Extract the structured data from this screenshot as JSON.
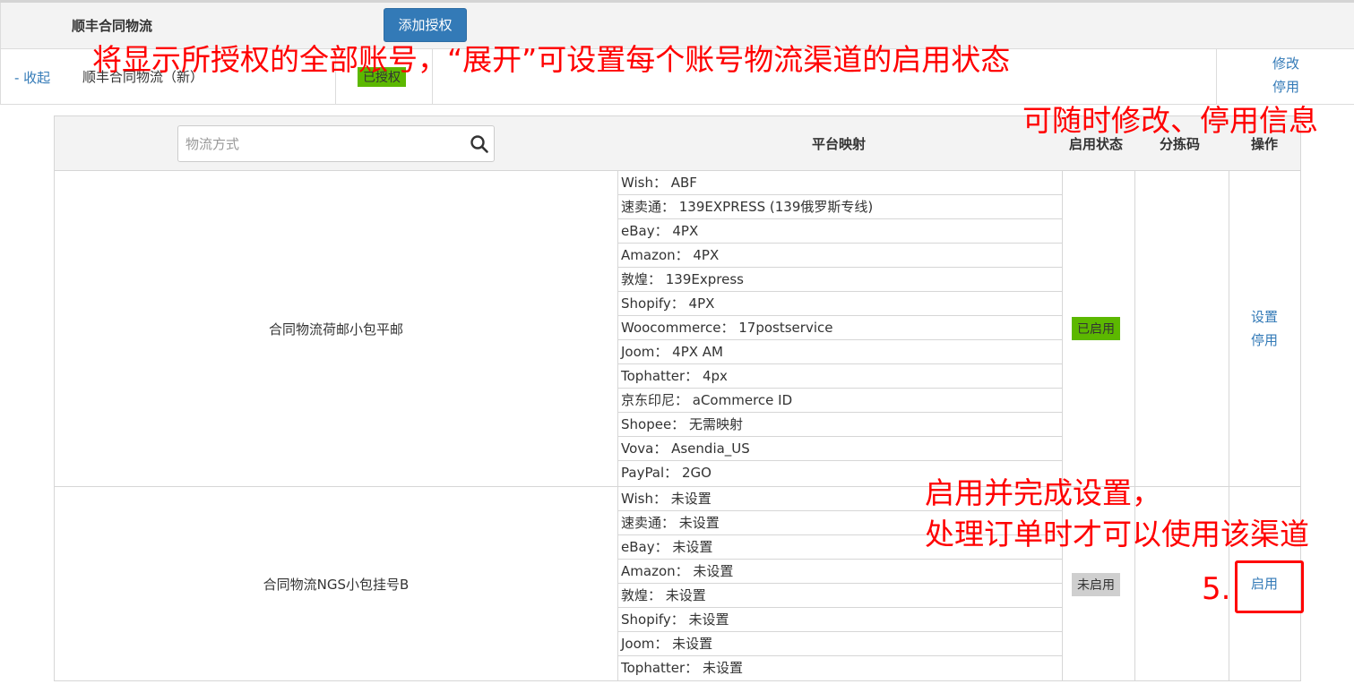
{
  "header": {
    "title": "顺丰合同物流",
    "add_button": "添加授权"
  },
  "account": {
    "collapse": "- 收起",
    "name": "顺丰合同物流（新）",
    "auth_status": "已授权",
    "ops": [
      "修改",
      "停用"
    ]
  },
  "table": {
    "search_placeholder": "物流方式",
    "headers": {
      "mapping": "平台映射",
      "status": "启用状态",
      "code": "分拣码",
      "ops": "操作"
    },
    "channels": [
      {
        "name": "合同物流荷邮小包平邮",
        "status": "已启用",
        "mappings": [
          "Wish： ABF",
          "速卖通： 139EXPRESS (139俄罗斯专线)",
          "eBay： 4PX",
          "Amazon： 4PX",
          "敦煌： 139Express",
          "Shopify： 4PX",
          "Woocommerce： 17postservice",
          "Joom： 4PX AM",
          "Tophatter： 4px",
          "京东印尼： aCommerce ID",
          "Shopee： 无需映射",
          "Vova： Asendia_US",
          "PayPal： 2GO"
        ],
        "ops": [
          "设置",
          "停用"
        ]
      },
      {
        "name": "合同物流NGS小包挂号B",
        "status": "未启用",
        "mappings": [
          "Wish： 未设置",
          "速卖通： 未设置",
          "eBay： 未设置",
          "Amazon： 未设置",
          "敦煌： 未设置",
          "Shopify： 未设置",
          "Joom： 未设置",
          "Tophatter： 未设置"
        ],
        "ops": [
          "启用"
        ]
      }
    ]
  },
  "annotations": {
    "a1": "将显示所授权的全部账号，“展开”可设置每个账号物流渠道的启用状态",
    "a2": "可随时修改、停用信息",
    "a3_line1": "启用并完成设置，",
    "a3_line2": "处理订单时才可以使用该渠道",
    "a4": "5."
  },
  "colors": {
    "primary": "#337ab7",
    "enabled": "#5cb800",
    "disabled": "#cfcfcf",
    "annotation": "#ff0000"
  }
}
